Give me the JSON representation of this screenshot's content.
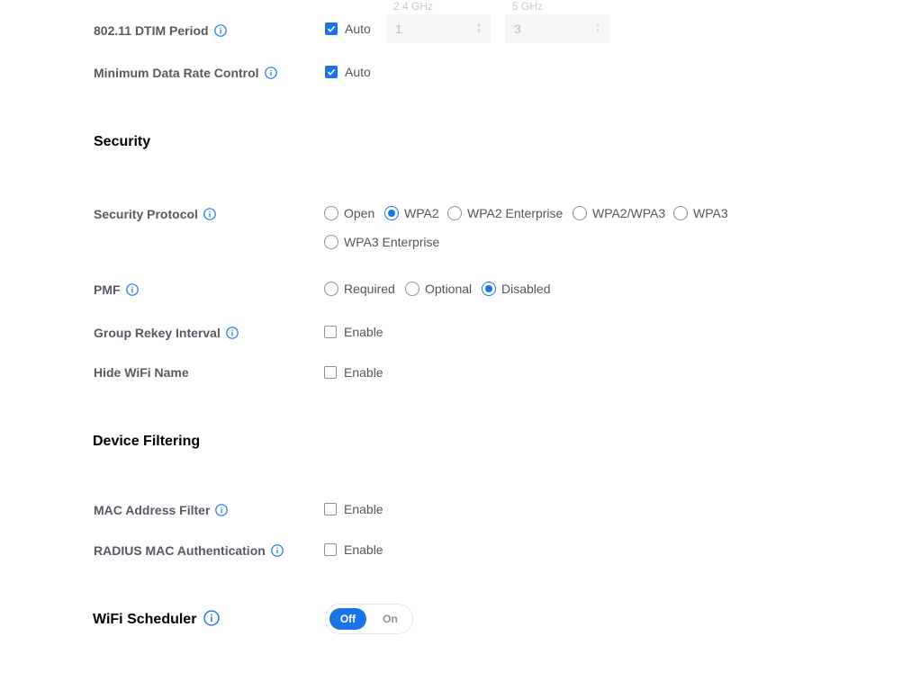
{
  "radio_section": {
    "dtim": {
      "label": "802.11 DTIM Period",
      "auto_label": "Auto",
      "auto_checked": true,
      "band_24_label": "2.4 GHz",
      "band_24_value": "1",
      "band_5_label": "5 GHz",
      "band_5_value": "3"
    },
    "min_rate": {
      "label": "Minimum Data Rate Control",
      "auto_label": "Auto",
      "auto_checked": true
    }
  },
  "security": {
    "title": "Security",
    "protocol": {
      "label": "Security Protocol",
      "options": [
        "Open",
        "WPA2",
        "WPA2 Enterprise",
        "WPA2/WPA3",
        "WPA3",
        "WPA3 Enterprise"
      ],
      "selected": "WPA2"
    },
    "pmf": {
      "label": "PMF",
      "options": [
        "Required",
        "Optional",
        "Disabled"
      ],
      "selected": "Disabled"
    },
    "group_rekey": {
      "label": "Group Rekey Interval",
      "enable_label": "Enable",
      "checked": false
    },
    "hide_wifi": {
      "label": "Hide WiFi Name",
      "enable_label": "Enable",
      "checked": false
    }
  },
  "device_filtering": {
    "title": "Device Filtering",
    "mac_filter": {
      "label": "MAC Address Filter",
      "enable_label": "Enable",
      "checked": false
    },
    "radius_mac": {
      "label": "RADIUS MAC Authentication",
      "enable_label": "Enable",
      "checked": false
    }
  },
  "scheduler": {
    "title": "WiFi Scheduler",
    "off_label": "Off",
    "on_label": "On",
    "state": "Off"
  },
  "colors": {
    "accent": "#1a73e8",
    "label_text": "#545b64",
    "heading_text": "#000000"
  },
  "icons": [
    "info-icon",
    "checkbox-checked-icon",
    "radio-icon"
  ]
}
